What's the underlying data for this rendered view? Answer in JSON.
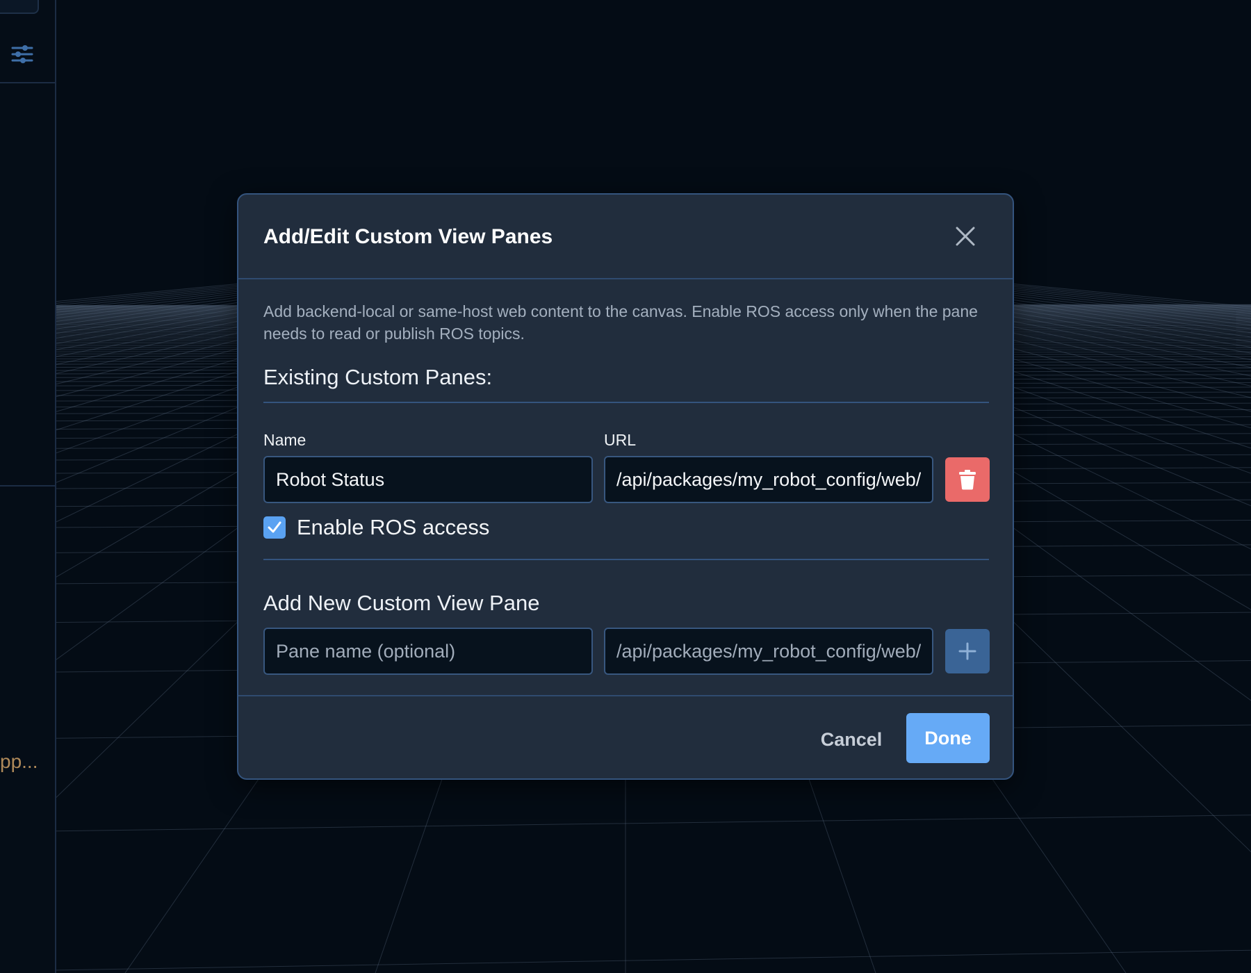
{
  "sidebar": {
    "settings_icon": "sliders-icon",
    "truncated_text": "pp..."
  },
  "dialog": {
    "title": "Add/Edit Custom View Panes",
    "close_icon": "close-icon",
    "description": "Add backend-local or same-host web content to the canvas. Enable ROS access only when the pane needs to read or publish ROS topics.",
    "existing": {
      "heading": "Existing Custom Panes:",
      "name_label": "Name",
      "url_label": "URL",
      "panes": [
        {
          "name": "Robot Status",
          "url": "/api/packages/my_robot_config/web/index.html",
          "ros_access": true,
          "ros_access_label": "Enable ROS access",
          "delete_icon": "trash-icon"
        }
      ]
    },
    "add_new": {
      "heading": "Add New Custom View Pane",
      "name_placeholder": "Pane name (optional)",
      "url_placeholder": "/api/packages/my_robot_config/web/index.html",
      "add_icon": "plus-icon"
    },
    "footer": {
      "cancel_label": "Cancel",
      "done_label": "Done"
    }
  },
  "colors": {
    "accent": "#66aaf6",
    "danger": "#ea6a69",
    "dialog_bg": "#212d3d",
    "border": "#34547e",
    "input_bg": "#07121d"
  }
}
